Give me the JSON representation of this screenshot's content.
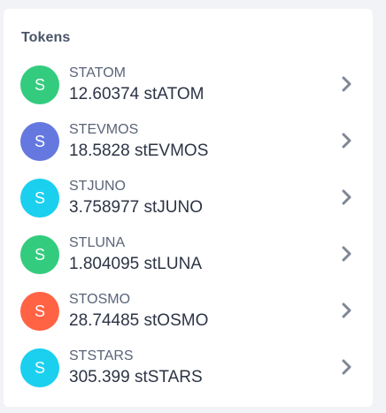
{
  "panel": {
    "title": "Tokens"
  },
  "tokens": [
    {
      "avatar_letter": "S",
      "symbol": "STATOM",
      "balance": "12.60374 stATOM",
      "color": "#33cc7e"
    },
    {
      "avatar_letter": "S",
      "symbol": "STEVMOS",
      "balance": "18.5828 stEVMOS",
      "color": "#6578e0"
    },
    {
      "avatar_letter": "S",
      "symbol": "STJUNO",
      "balance": "3.758977 stJUNO",
      "color": "#1ad0ee"
    },
    {
      "avatar_letter": "S",
      "symbol": "STLUNA",
      "balance": "1.804095 stLUNA",
      "color": "#33cc7e"
    },
    {
      "avatar_letter": "S",
      "symbol": "STOSMO",
      "balance": "28.74485 stOSMO",
      "color": "#ff6344"
    },
    {
      "avatar_letter": "S",
      "symbol": "STSTARS",
      "balance": "305.399 stSTARS",
      "color": "#1ad0ee"
    }
  ],
  "icons": {
    "row_action": "chevron-right-icon"
  }
}
